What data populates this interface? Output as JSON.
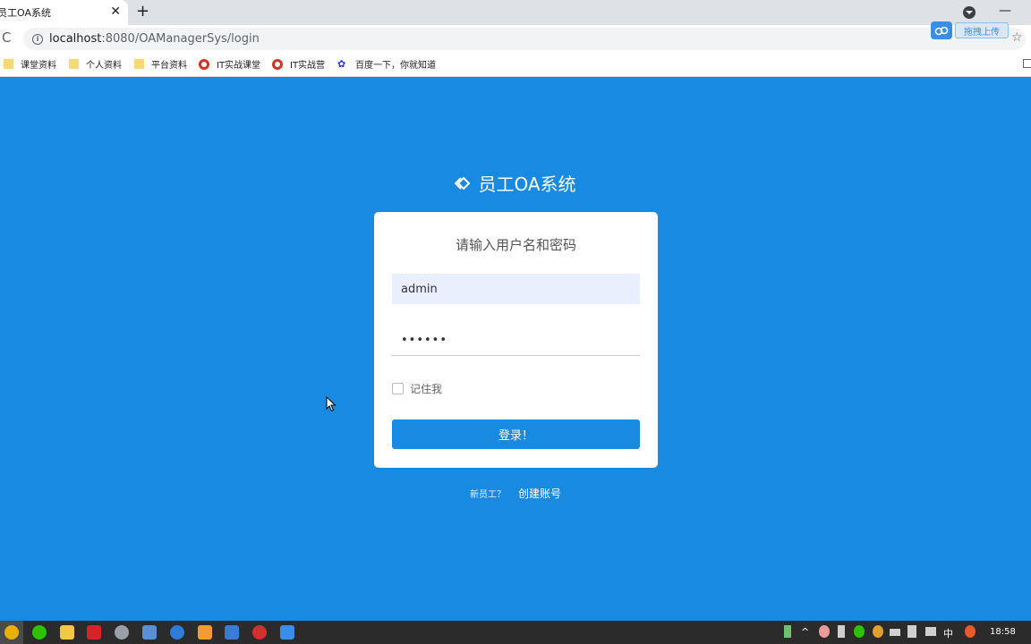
{
  "browser": {
    "tab_title": "员工OA系统",
    "tab_close": "✕",
    "new_tab": "+",
    "reload": "C",
    "url_host": "localhost",
    "url_path": ":8080/OAManagerSys/login",
    "star": "☆",
    "minimize": "—",
    "upload_label": "拖拽上传"
  },
  "bookmarks": [
    {
      "label": "课堂资料",
      "icon": "folder-icon"
    },
    {
      "label": "个人资料",
      "icon": "folder-icon"
    },
    {
      "label": "平台资料",
      "icon": "folder-icon"
    },
    {
      "label": "IT实战课堂",
      "icon": "redcircle-icon"
    },
    {
      "label": "IT实战营",
      "icon": "redcircle-icon"
    },
    {
      "label": "百度一下，你就知道",
      "icon": "paw-icon"
    }
  ],
  "login": {
    "brand": "员工OA系统",
    "card_title": "请输入用户名和密码",
    "username_value": "admin",
    "password_value": "••••••",
    "remember_label": "记住我",
    "login_button": "登录！",
    "new_staff": "新员工？",
    "create_account": "创建账号"
  },
  "taskbar": {
    "ime": "中",
    "clock": "18:58"
  },
  "colors": {
    "page_bg": "#188ae2",
    "button": "#188ae2",
    "card": "#ffffff"
  }
}
